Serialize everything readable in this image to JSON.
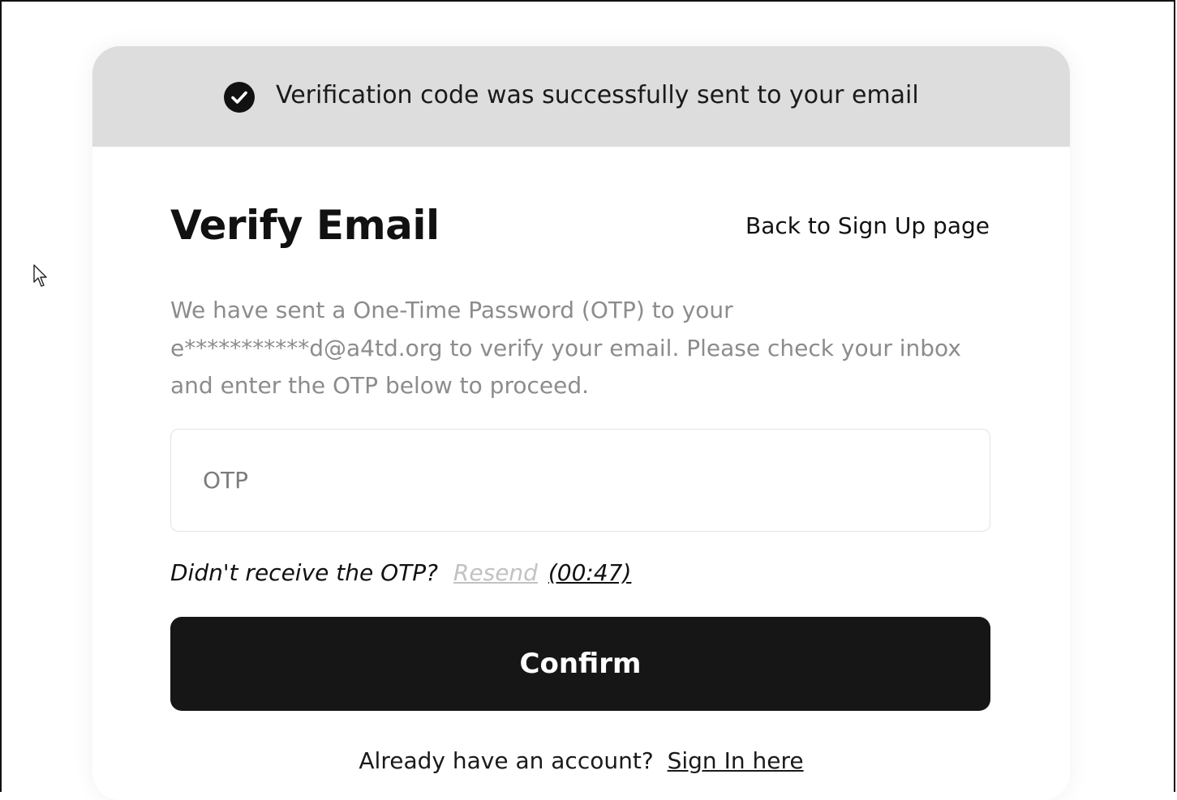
{
  "banner": {
    "icon": "check-circle-icon",
    "message": "Verification code was successfully sent to your email"
  },
  "header": {
    "title": "Verify Email",
    "back_link": "Back to Sign Up page"
  },
  "description": "We have sent a One-Time Password (OTP) to your e***********d@a4td.org to verify your email. Please check your inbox and enter the OTP below to proceed.",
  "otp_field": {
    "placeholder": "OTP",
    "value": ""
  },
  "resend": {
    "question": "Didn't receive the OTP?",
    "link_label": "Resend",
    "timer": "(00:47)"
  },
  "confirm_button": {
    "label": "Confirm"
  },
  "footer": {
    "prompt": "Already have an account?",
    "signin_link": "Sign In here"
  },
  "colors": {
    "banner_bg": "#dddddd",
    "button_bg": "#161616",
    "muted_text": "#8c8c8c",
    "disabled_link": "#c2c2c2"
  }
}
